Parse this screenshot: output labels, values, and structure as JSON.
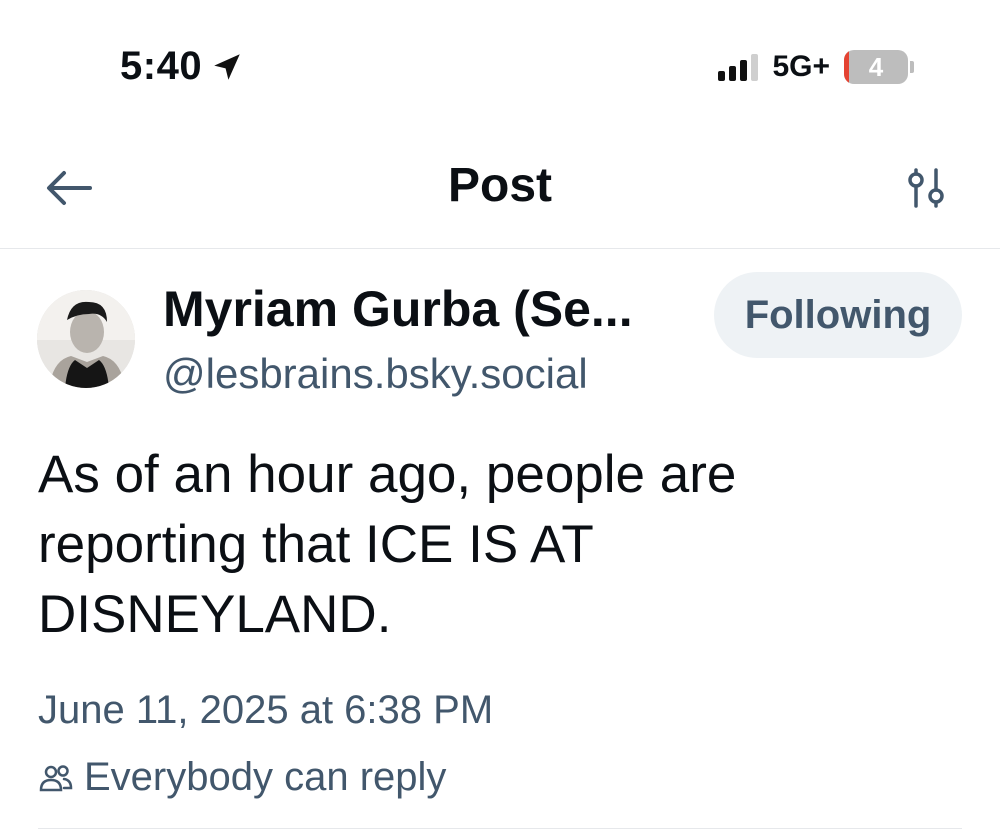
{
  "status_bar": {
    "time": "5:40",
    "network": "5G+",
    "battery_label": "4",
    "battery_level": 0.04,
    "signal_bars": 3,
    "signal_bars_total": 4
  },
  "header": {
    "title": "Post",
    "back_icon": "arrow-left-icon",
    "filter_icon": "sliders-icon"
  },
  "post": {
    "author": {
      "display_name": "Myriam Gurba (Se...",
      "handle": "@lesbrains.bsky.social"
    },
    "follow_button_label": "Following",
    "text": "As of an hour ago, people are reporting that ICE IS AT DISNEYLAND.",
    "timestamp": "June 11, 2025 at 6:38 PM",
    "reply_setting": "Everybody can reply"
  },
  "colors": {
    "text_primary": "#0b0f14",
    "text_secondary": "#42576c",
    "follow_bg": "#eef2f5",
    "divider": "#e6e8eb",
    "battery_low": "#e44332"
  }
}
